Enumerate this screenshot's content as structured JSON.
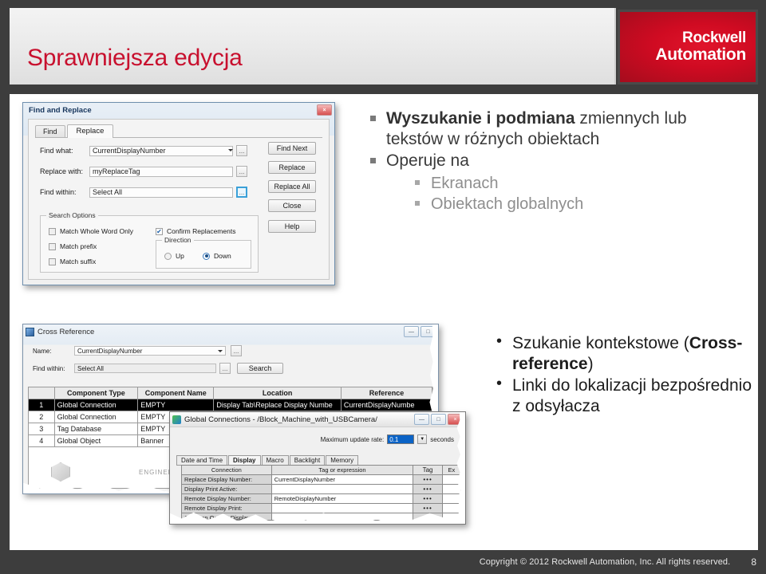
{
  "slide": {
    "title": "Sprawniejsza edycja",
    "brand": {
      "line1": "Rockwell",
      "line2": "Automation",
      "color": "#c8102e"
    },
    "footer": {
      "copyright": "Copyright © 2012 Rockwell Automation, Inc. All rights reserved.",
      "page_number": "8"
    }
  },
  "bullets_top": [
    {
      "bold": "Wyszukanie i podmiana",
      "rest": " zmiennych lub tekstów w różnych obiektach"
    },
    {
      "bold": "",
      "rest": "Operuje na"
    }
  ],
  "bullets_top_sub": [
    "Ekranach",
    "Obiektach globalnych"
  ],
  "bullets_bottom": [
    {
      "pre": "Szukanie kontekstowe (",
      "bold": "Cross-reference",
      "post": ")"
    },
    {
      "pre": "Linki do lokalizacji bezpośrednio z odsyłacza",
      "bold": "",
      "post": ""
    }
  ],
  "find_replace": {
    "title": "Find and Replace",
    "close_glyph": "×",
    "tabs": [
      {
        "label": "Find",
        "active": false
      },
      {
        "label": "Replace",
        "active": true
      }
    ],
    "fields": [
      {
        "label": "Find what:",
        "value": "CurrentDisplayNumber",
        "browse": "...",
        "combo": true
      },
      {
        "label": "Replace with:",
        "value": "myReplaceTag",
        "browse": "...",
        "combo": false
      },
      {
        "label": "Find within:",
        "value": "Select All",
        "browse": "...",
        "combo": false
      }
    ],
    "buttons": [
      "Find Next",
      "Replace",
      "Replace All",
      "Close",
      "Help"
    ],
    "search_options": {
      "label": "Search Options",
      "checkboxes": [
        {
          "label": "Match Whole Word Only",
          "checked": false
        },
        {
          "label": "Match prefix",
          "checked": false
        },
        {
          "label": "Match suffix",
          "checked": false
        },
        {
          "label": "Confirm Replacements",
          "checked": true
        }
      ],
      "direction": {
        "label": "Direction",
        "options": [
          {
            "label": "Up",
            "selected": false
          },
          {
            "label": "Down",
            "selected": true
          }
        ]
      }
    }
  },
  "cross_reference": {
    "title": "Cross Reference",
    "minimize_glyph": "—",
    "maximize_glyph": "□",
    "fields": [
      {
        "label": "Name:",
        "value": "CurrentDisplayNumber",
        "browse": "...",
        "combo": true
      },
      {
        "label": "Find within:",
        "value": "Select All",
        "browse": "...",
        "combo": false
      }
    ],
    "search_button": "Search",
    "columns": [
      "",
      "Component Type",
      "Component  Name",
      "Location",
      "Reference"
    ],
    "rows": [
      {
        "idx": "1",
        "type": "Global Connection",
        "name": "EMPTY",
        "location": "Display Tab\\Replace Display Numbe",
        "reference": "CurrentDisplayNumbe",
        "selected": true
      },
      {
        "idx": "2",
        "type": "Global Connection",
        "name": "EMPTY",
        "location": "",
        "reference": "",
        "selected": false
      },
      {
        "idx": "3",
        "type": "Tag Database",
        "name": "EMPTY",
        "location": "",
        "reference": "",
        "selected": false
      },
      {
        "idx": "4",
        "type": "Global Object",
        "name": "Banner",
        "location": "",
        "reference": "",
        "selected": false
      }
    ],
    "watermark": "ENGINEERING"
  },
  "global_connections": {
    "title": "Global Connections - /Block_Machine_with_USBCamera/",
    "minimize_glyph": "—",
    "maximize_glyph": "□",
    "close_glyph": "×",
    "update_rate": {
      "label": "Maximum update rate:",
      "value": "0.1",
      "unit": "seconds",
      "caret": "▼"
    },
    "tabs": [
      {
        "label": "Date and Time",
        "active": false
      },
      {
        "label": "Display",
        "active": true
      },
      {
        "label": "Macro",
        "active": false
      },
      {
        "label": "Backlight",
        "active": false
      },
      {
        "label": "Memory",
        "active": false
      }
    ],
    "columns": [
      "Connection",
      "Tag or expression",
      "Tag",
      "Ex"
    ],
    "rows": [
      {
        "connection": "Replace Display Number:",
        "expression": "CurrentDisplayNumber",
        "tag": "•••"
      },
      {
        "connection": "Display Print Active:",
        "expression": "",
        "tag": "•••"
      },
      {
        "connection": "Remote Display Number:",
        "expression": "RemoteDisplayNumber",
        "tag": "•••"
      },
      {
        "connection": "Remote Display Print:",
        "expression": "",
        "tag": "•••"
      },
      {
        "connection": "Close an On Top Display:",
        "expression": "",
        "tag": "•••"
      }
    ]
  }
}
